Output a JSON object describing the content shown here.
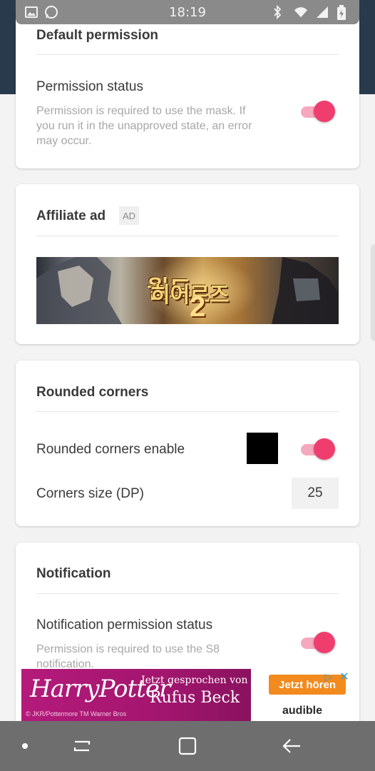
{
  "status_bar": {
    "time": "18:19",
    "left_icons": [
      "gallery-icon",
      "whatsapp-icon"
    ],
    "right_icons": [
      "bluetooth-icon",
      "wifi-icon",
      "signal-icon",
      "battery-icon"
    ]
  },
  "cards": {
    "default_permission": {
      "title": "Default permission",
      "row_label": "Permission status",
      "row_desc": "Permission is required to use the mask. If you run it in the unapproved state, an error may occur.",
      "toggle_on": true
    },
    "affiliate_ad": {
      "title": "Affiliate ad",
      "badge": "AD",
      "banner_title": "월드",
      "banner_subtitle": "히어로즈",
      "banner_number": "2"
    },
    "rounded_corners": {
      "title": "Rounded corners",
      "enable_label": "Rounded corners enable",
      "swatch_color": "#000000",
      "toggle_on": true,
      "size_label": "Corners size (DP)",
      "size_value": "25"
    },
    "notification": {
      "title": "Notification",
      "row_label": "Notification permission status",
      "row_desc": "Permission is required to use the S8 notification.",
      "toggle_on": true
    }
  },
  "bottom_ad": {
    "brand": "HarryPotter",
    "line1": "Jetzt gesprochen von",
    "line2": "Rufus Beck",
    "copyright": "© JKR/Pottermore  TM Warner Bros",
    "cta": "Jetzt hören",
    "partner": "audible"
  },
  "colors": {
    "accent": "#ef3e6e",
    "accent_track": "#f6a8bf",
    "header": "#2a3a4d"
  },
  "nav": {
    "icons": [
      "dot-icon",
      "recents-icon",
      "home-icon",
      "back-icon"
    ]
  }
}
